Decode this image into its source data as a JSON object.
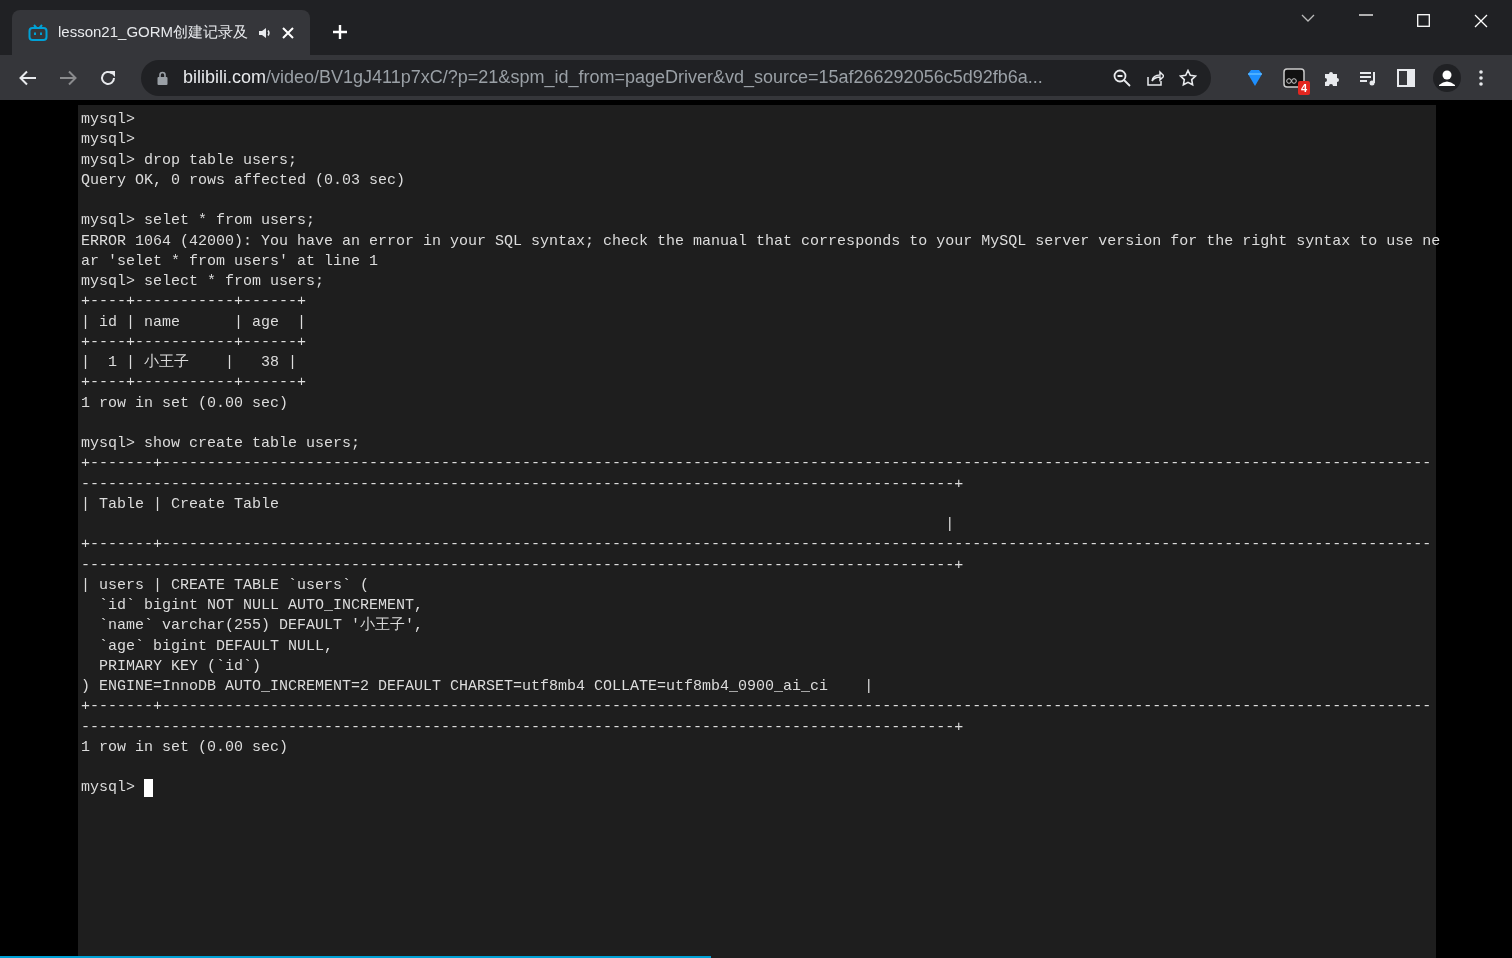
{
  "tab": {
    "title": "lesson21_GORM创建记录及",
    "selected": true,
    "audio_playing": true
  },
  "address_bar": {
    "domain": "bilibili.com",
    "path": "/video/BV1gJ411p7xC/?p=21&spm_id_from=pageDriver&vd_source=15af266292056c5d92fb6a..."
  },
  "extension_badge": "4",
  "terminal": {
    "lines": [
      {
        "kind": "text",
        "text": "mysql>"
      },
      {
        "kind": "text",
        "text": "mysql>"
      },
      {
        "kind": "text",
        "text": "mysql> drop table users;"
      },
      {
        "kind": "text",
        "text": "Query OK, 0 rows affected (0.03 sec)"
      },
      {
        "kind": "blank"
      },
      {
        "kind": "text",
        "text": "mysql> selet * from users;"
      },
      {
        "kind": "text",
        "text": "ERROR 1064 (42000): You have an error in your SQL syntax; check the manual that corresponds to your MySQL server version for the right syntax to use ne"
      },
      {
        "kind": "text",
        "text": "ar 'selet * from users' at line 1"
      },
      {
        "kind": "text",
        "text": "mysql> select * from users;"
      },
      {
        "kind": "text",
        "text": "+----+-----------+------+"
      },
      {
        "kind": "text",
        "text": "| id | name      | age  |"
      },
      {
        "kind": "text",
        "text": "+----+-----------+------+"
      },
      {
        "kind": "text",
        "text": "|  1 | 小王子    |   38 |"
      },
      {
        "kind": "text",
        "text": "+----+-----------+------+"
      },
      {
        "kind": "text",
        "text": "1 row in set (0.00 sec)"
      },
      {
        "kind": "blank"
      },
      {
        "kind": "text",
        "text": "mysql> show create table users;"
      },
      {
        "kind": "text",
        "text": "+-------+---------------------------------------------------------------------------------------------------------------------------------------------"
      },
      {
        "kind": "text",
        "text": "-------------------------------------------------------------------------------------------------+"
      },
      {
        "kind": "text",
        "text": "| Table | Create Table"
      },
      {
        "kind": "text",
        "text": "                                                                                                |"
      },
      {
        "kind": "text",
        "text": "+-------+---------------------------------------------------------------------------------------------------------------------------------------------"
      },
      {
        "kind": "text",
        "text": "-------------------------------------------------------------------------------------------------+"
      },
      {
        "kind": "text",
        "text": "| users | CREATE TABLE `users` ("
      },
      {
        "kind": "text",
        "text": "  `id` bigint NOT NULL AUTO_INCREMENT,"
      },
      {
        "kind": "text",
        "text": "  `name` varchar(255) DEFAULT '小王子',"
      },
      {
        "kind": "text",
        "text": "  `age` bigint DEFAULT NULL,"
      },
      {
        "kind": "text",
        "text": "  PRIMARY KEY (`id`)"
      },
      {
        "kind": "text",
        "text": ") ENGINE=InnoDB AUTO_INCREMENT=2 DEFAULT CHARSET=utf8mb4 COLLATE=utf8mb4_0900_ai_ci    |"
      },
      {
        "kind": "text",
        "text": "+-------+---------------------------------------------------------------------------------------------------------------------------------------------"
      },
      {
        "kind": "text",
        "text": "-------------------------------------------------------------------------------------------------+"
      },
      {
        "kind": "text",
        "text": "1 row in set (0.00 sec)"
      },
      {
        "kind": "blank"
      },
      {
        "kind": "prompt",
        "text": "mysql>"
      }
    ]
  },
  "video_progress": {
    "level": 0.47
  }
}
